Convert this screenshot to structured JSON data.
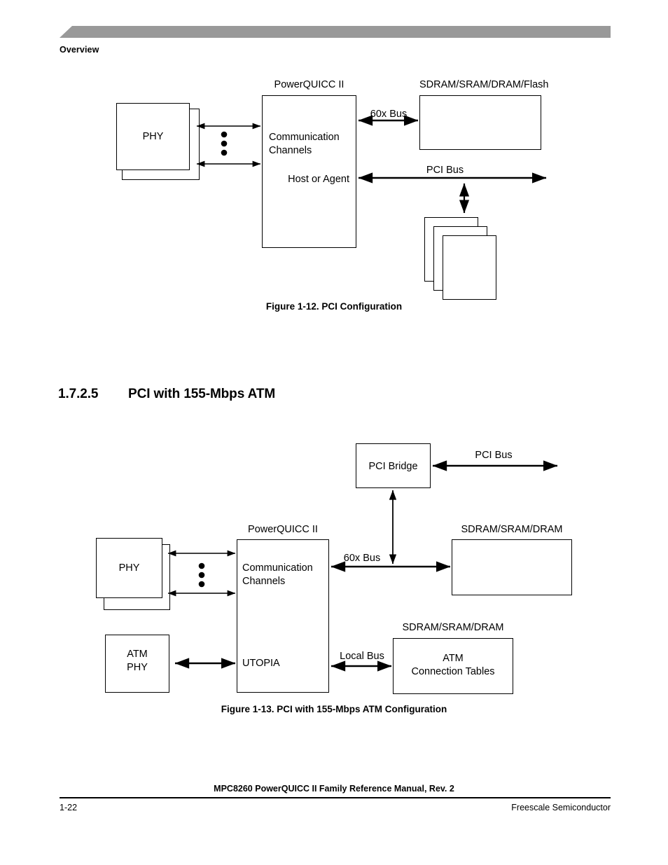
{
  "header": {
    "title": "Overview"
  },
  "figure1": {
    "caption": "Figure 1-12. PCI Configuration",
    "powerquicc_label": "PowerQUICC II",
    "memory_label": "SDRAM/SRAM/DRAM/Flash",
    "phy_label": "PHY",
    "comm_line1": "Communication",
    "comm_line2": "Channels",
    "host_label": "Host or Agent",
    "bus_60x": "60x Bus",
    "bus_pci": "PCI Bus"
  },
  "section": {
    "number": "1.7.2.5",
    "title": "PCI with 155-Mbps ATM"
  },
  "figure2": {
    "caption": "Figure 1-13. PCI with 155-Mbps ATM Configuration",
    "bridge_label": "PCI Bridge",
    "bus_pci": "PCI Bus",
    "powerquicc_label": "PowerQUICC II",
    "memory_label": "SDRAM/SRAM/DRAM",
    "phy_label": "PHY",
    "comm_line1": "Communication",
    "comm_line2": "Channels",
    "bus_60x": "60x Bus",
    "atm_phy_line1": "ATM",
    "atm_phy_line2": "PHY",
    "utopia_label": "UTOPIA",
    "bus_local": "Local Bus",
    "atm_mem_label": "SDRAM/SRAM/DRAM",
    "atm_tables_line1": "ATM",
    "atm_tables_line2": "Connection Tables"
  },
  "footer": {
    "manual_title": "MPC8260 PowerQUICC II Family Reference Manual, Rev. 2",
    "page_number": "1-22",
    "company": "Freescale Semiconductor"
  },
  "colors": {
    "header_bar": "#999999",
    "ink": "#000000",
    "paper": "#ffffff"
  }
}
